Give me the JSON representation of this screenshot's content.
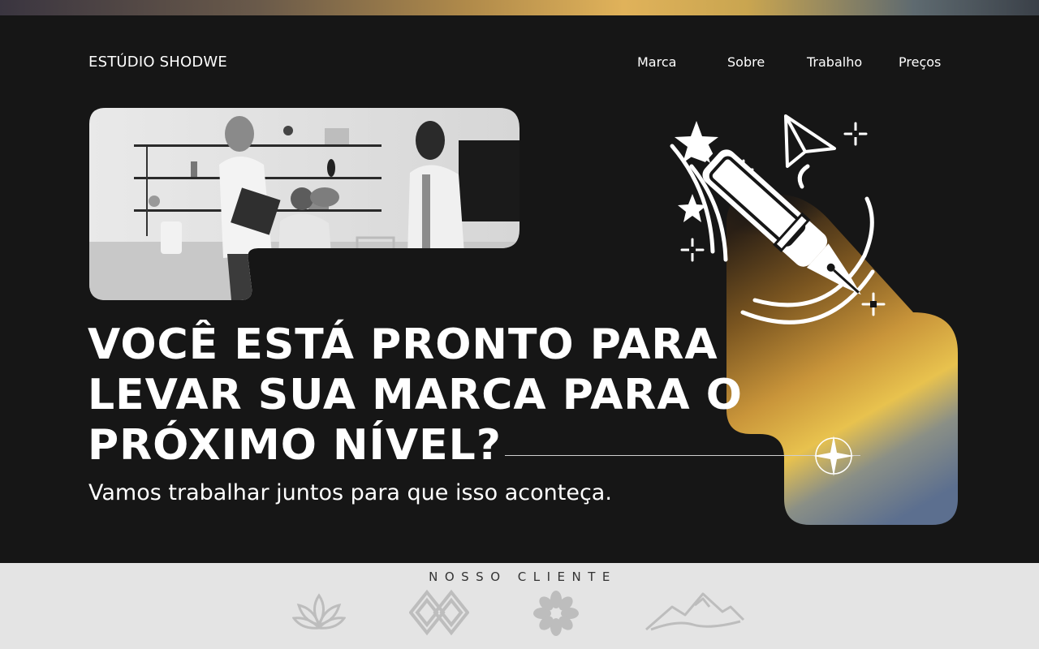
{
  "header": {
    "brand": "ESTÚDIO SHODWE",
    "nav": [
      "Marca",
      "Sobre",
      "Trabalho",
      "Preços"
    ]
  },
  "hero": {
    "headline_lines": [
      "VOCÊ ESTÁ PRONTO PARA",
      "LEVAR SUA MARCA PARA O",
      "PRÓXIMO NÍVEL?"
    ],
    "subheadline": "Vamos trabalhar juntos para que isso aconteça."
  },
  "clients": {
    "title": "NOSSO CLIENTE",
    "logos": [
      "lotus-logo",
      "diamond-knot-logo",
      "flower-logo",
      "mountain-logo"
    ]
  },
  "colors": {
    "background": "#161616",
    "clients_background": "#e4e4e4",
    "accent_gold": "#e8b84a",
    "accent_blue": "#6f86a8"
  }
}
